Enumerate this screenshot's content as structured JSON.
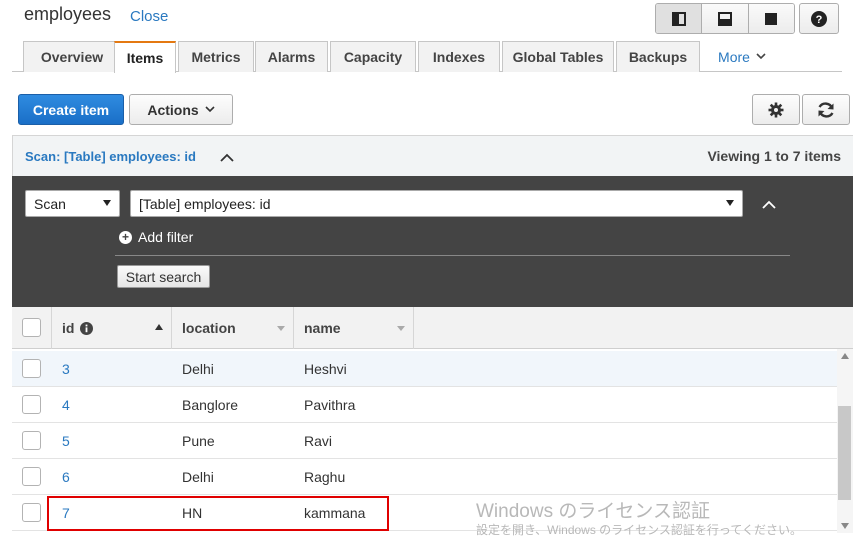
{
  "header": {
    "title": "employees",
    "close_label": "Close"
  },
  "layout_icons": [
    "split-vertical-icon",
    "split-horizontal-icon",
    "fullscreen-icon"
  ],
  "help_label": "?",
  "tabs": [
    {
      "label": "Overview"
    },
    {
      "label": "Items",
      "active": true
    },
    {
      "label": "Metrics"
    },
    {
      "label": "Alarms"
    },
    {
      "label": "Capacity"
    },
    {
      "label": "Indexes"
    },
    {
      "label": "Global Tables"
    },
    {
      "label": "Backups"
    }
  ],
  "more_label": "More",
  "toolbar": {
    "create_label": "Create item",
    "actions_label": "Actions"
  },
  "scan": {
    "title": "Scan: [Table] employees: id",
    "viewing": "Viewing 1 to 7 items",
    "mode": "Scan",
    "target": "[Table] employees: id",
    "add_filter": "Add filter",
    "start_search": "Start search"
  },
  "table": {
    "columns": [
      {
        "label": "id"
      },
      {
        "label": "location"
      },
      {
        "label": "name"
      }
    ],
    "rows": [
      {
        "id": "3",
        "location": "Delhi",
        "name": "Heshvi"
      },
      {
        "id": "4",
        "location": "Banglore",
        "name": "Pavithra"
      },
      {
        "id": "5",
        "location": "Pune",
        "name": "Ravi"
      },
      {
        "id": "6",
        "location": "Delhi",
        "name": "Raghu"
      },
      {
        "id": "7",
        "location": "HN",
        "name": "kammana"
      }
    ]
  },
  "watermark": {
    "line1": "Windows のライセンス認証",
    "line2": "設定を開き、Windows のライセンス認証を行ってください。"
  },
  "colors": {
    "accent": "#1a6fc7",
    "link": "#2a79c0",
    "tab_active": "#e47911",
    "highlight": "#e00000"
  }
}
